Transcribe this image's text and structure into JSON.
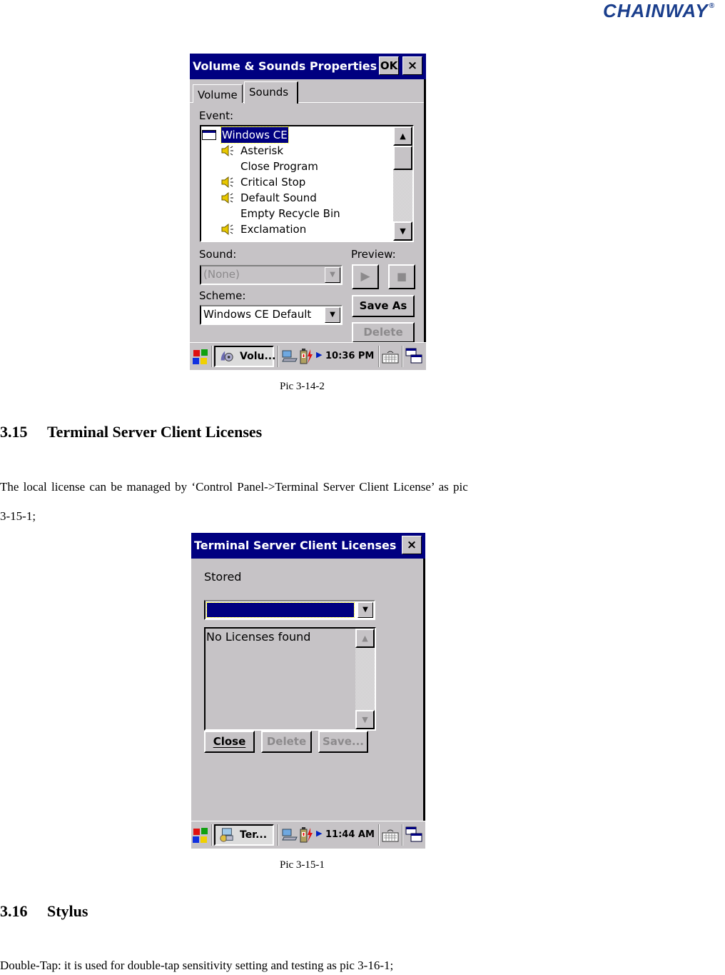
{
  "header": {
    "brand": "CHAINWAY",
    "registered_mark": "®"
  },
  "figure1": {
    "window_title": "Volume & Sounds Properties",
    "ok_label": "OK",
    "close_label": "×",
    "tabs": [
      {
        "label": "Volume",
        "active": false
      },
      {
        "label": "Sounds",
        "active": true
      }
    ],
    "event_label": "Event:",
    "events": [
      {
        "label": "Windows CE",
        "icon": "window-icon",
        "selected": true,
        "indent": 0
      },
      {
        "label": "Asterisk",
        "icon": "speaker-icon",
        "selected": false,
        "indent": 1
      },
      {
        "label": "Close Program",
        "icon": "",
        "selected": false,
        "indent": 1
      },
      {
        "label": "Critical Stop",
        "icon": "speaker-icon",
        "selected": false,
        "indent": 1
      },
      {
        "label": "Default Sound",
        "icon": "speaker-icon",
        "selected": false,
        "indent": 1
      },
      {
        "label": "Empty Recycle Bin",
        "icon": "",
        "selected": false,
        "indent": 1
      },
      {
        "label": "Exclamation",
        "icon": "speaker-icon",
        "selected": false,
        "indent": 1
      }
    ],
    "sound_label": "Sound:",
    "sound_value": "(None)",
    "preview_label": "Preview:",
    "play_icon": "▶",
    "stop_icon": "■",
    "scheme_label": "Scheme:",
    "scheme_value": "Windows CE Default",
    "save_as_label": "Save As",
    "delete_label": "Delete",
    "taskbar": {
      "task_label": "Volu...",
      "clock": "10:36 PM"
    },
    "caption": "Pic 3-14-2"
  },
  "section_315": {
    "number": "3.15",
    "title": "Terminal Server Client Licenses",
    "paragraph_line1": "The local license can be managed by ‘Control Panel->Terminal Server Client License’ as pic",
    "paragraph_line2": "3-15-1;"
  },
  "figure2": {
    "window_title": "Terminal Server Client Licenses",
    "close_label": "×",
    "stored_label": "Stored",
    "stored_value": "",
    "list_text": "No Licenses found",
    "buttons": {
      "close": "Close",
      "delete": "Delete",
      "save": "Save..."
    },
    "taskbar": {
      "task_label": "Ter...",
      "clock": "11:44 AM"
    },
    "caption": "Pic 3-15-1"
  },
  "section_316": {
    "number": "3.16",
    "title": "Stylus",
    "paragraph": "Double-Tap: it is used for double-tap sensitivity setting and testing as pic 3-16-1;"
  }
}
